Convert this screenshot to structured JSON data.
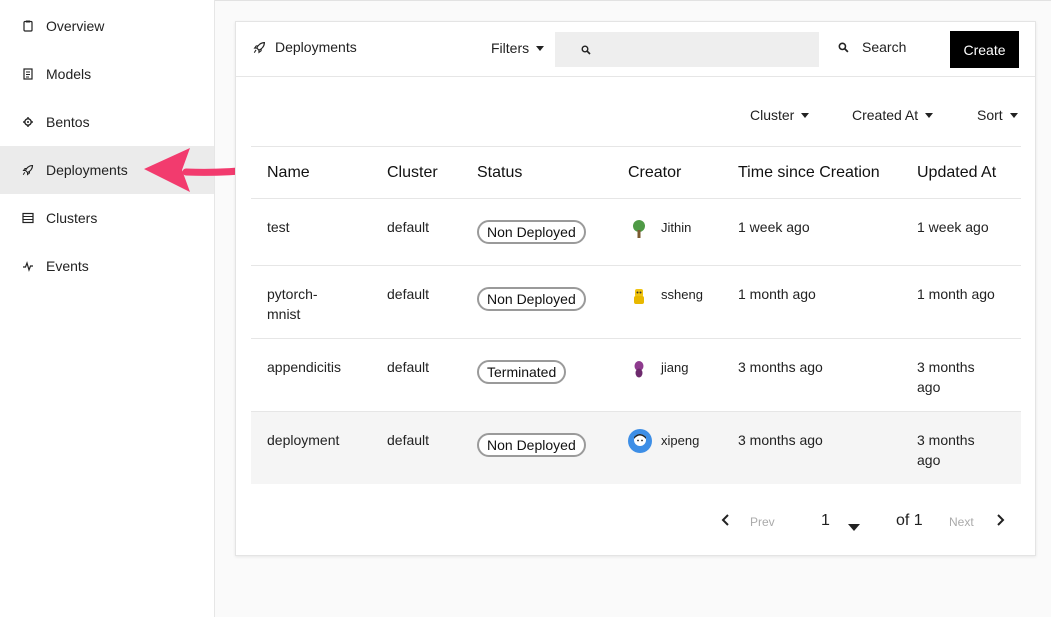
{
  "sidebar": {
    "items": [
      {
        "label": "Overview",
        "icon": "clipboard-icon"
      },
      {
        "label": "Models",
        "icon": "model-icon"
      },
      {
        "label": "Bentos",
        "icon": "bento-icon"
      },
      {
        "label": "Deployments",
        "icon": "rocket-icon",
        "active": true
      },
      {
        "label": "Clusters",
        "icon": "server-icon"
      },
      {
        "label": "Events",
        "icon": "activity-icon"
      }
    ]
  },
  "header": {
    "title": "Deployments",
    "filters_label": "Filters",
    "search_placeholder": "",
    "search_label": "Search",
    "create_label": "Create"
  },
  "subfilters": {
    "cluster": "Cluster",
    "created_at": "Created At",
    "sort": "Sort"
  },
  "table": {
    "columns": [
      "Name",
      "Cluster",
      "Status",
      "Creator",
      "Time since Creation",
      "Updated At"
    ],
    "rows": [
      {
        "name": "test",
        "cluster": "default",
        "status": "Non Deployed",
        "creator": "Jithin",
        "time_since": "1 week ago",
        "updated": "1 week ago"
      },
      {
        "name": "pytorch-mnist",
        "cluster": "default",
        "status": "Non Deployed",
        "creator": "ssheng",
        "time_since": "1 month ago",
        "updated": "1 month ago"
      },
      {
        "name": "appendicitis",
        "cluster": "default",
        "status": "Terminated",
        "creator": "jiang",
        "time_since": "3 months ago",
        "updated": "3 months ago"
      },
      {
        "name": "deployment",
        "cluster": "default",
        "status": "Non Deployed",
        "creator": "xipeng",
        "time_since": "3 months ago",
        "updated": "3 months ago"
      }
    ]
  },
  "pagination": {
    "prev_label": "Prev",
    "next_label": "Next",
    "current_page": "1",
    "total_label": "of 1"
  },
  "colors": {
    "accent_arrow": "#f23b6e",
    "primary_button": "#000000",
    "active_nav_bg": "#ebebeb"
  }
}
